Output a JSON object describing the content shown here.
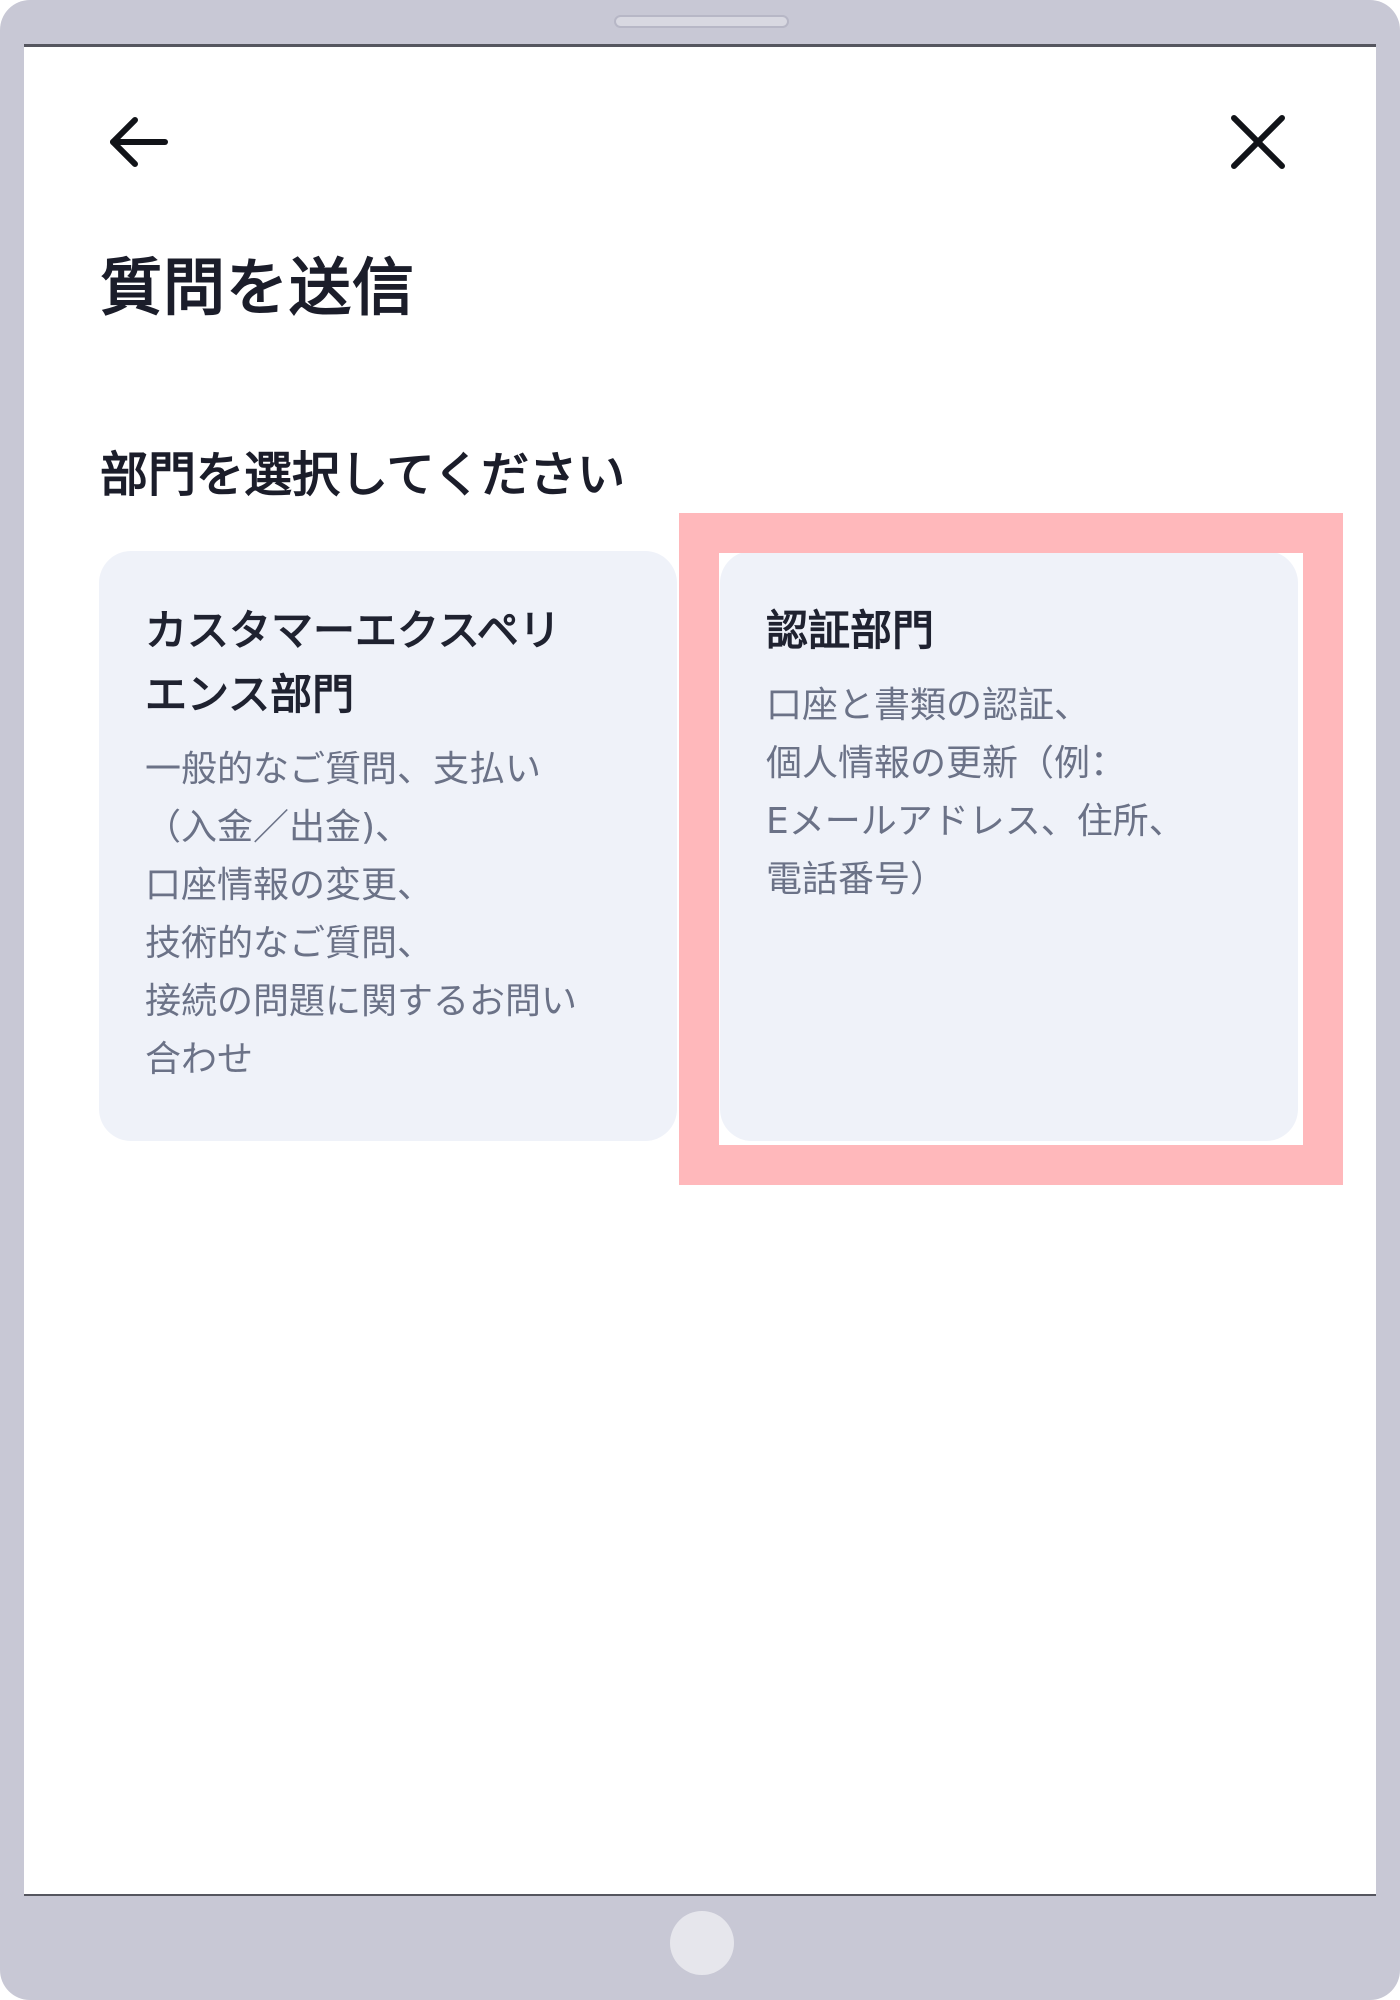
{
  "header": {
    "back_icon": "arrow-left-icon",
    "close_icon": "close-icon"
  },
  "page": {
    "title": "質問を送信",
    "section_label": "部門を選択してください"
  },
  "departments": [
    {
      "title": "カスタマーエクスペリ\nエンス部門",
      "description": "一般的なご質問、支払い\n（入金／出金)、\n口座情報の変更、\n技術的なご質問、\n接続の問題に関するお問い\n合わせ"
    },
    {
      "title": "認証部門",
      "description": "口座と書類の認証、\n個人情報の更新（例：\nEメールアドレス、住所、\n電話番号）"
    }
  ],
  "colors": {
    "device_frame": "#c8c8d5",
    "card_background": "#eff2f9",
    "highlight": "#ffb8bb",
    "title_text": "#1b1d2a",
    "description_text": "#6b7287"
  }
}
